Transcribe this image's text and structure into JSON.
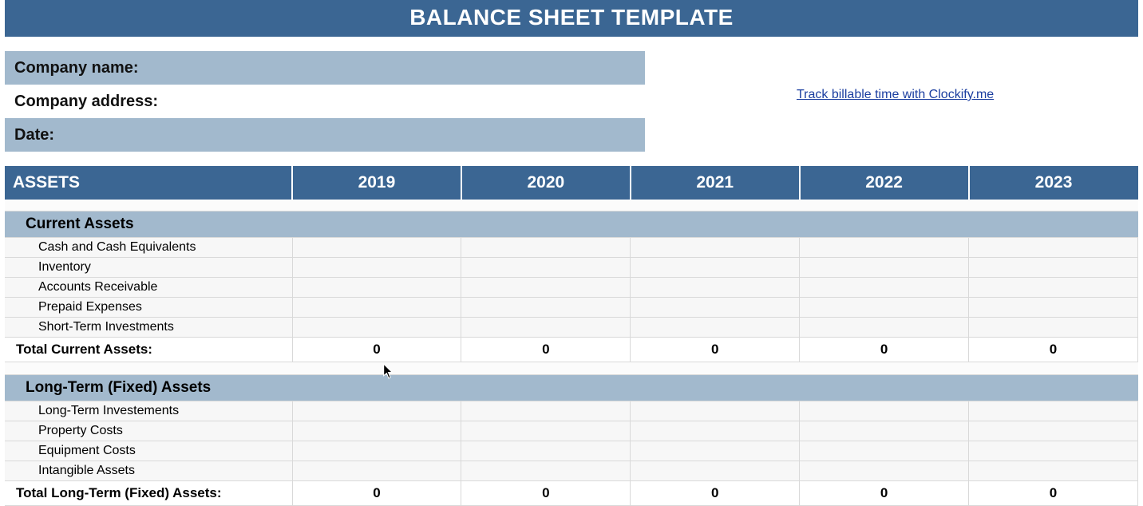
{
  "title": "BALANCE SHEET TEMPLATE",
  "info": {
    "company_name_label": "Company name:",
    "company_address_label": "Company address:",
    "date_label": "Date:"
  },
  "link_text": "Track billable time with Clockify.me",
  "table": {
    "header_label": "ASSETS",
    "years": [
      "2019",
      "2020",
      "2021",
      "2022",
      "2023"
    ],
    "section1": {
      "title": "Current Assets",
      "rows": [
        "Cash and Cash Equivalents",
        "Inventory",
        "Accounts Receivable",
        "Prepaid Expenses",
        "Short-Term Investments"
      ],
      "total_label": "Total Current Assets:",
      "totals": [
        "0",
        "0",
        "0",
        "0",
        "0"
      ]
    },
    "section2": {
      "title": "Long-Term (Fixed) Assets",
      "rows": [
        "Long-Term Investements",
        "Property Costs",
        "Equipment Costs",
        "Intangible Assets"
      ],
      "total_label": "Total Long-Term (Fixed) Assets:",
      "totals": [
        "0",
        "0",
        "0",
        "0",
        "0"
      ]
    }
  }
}
